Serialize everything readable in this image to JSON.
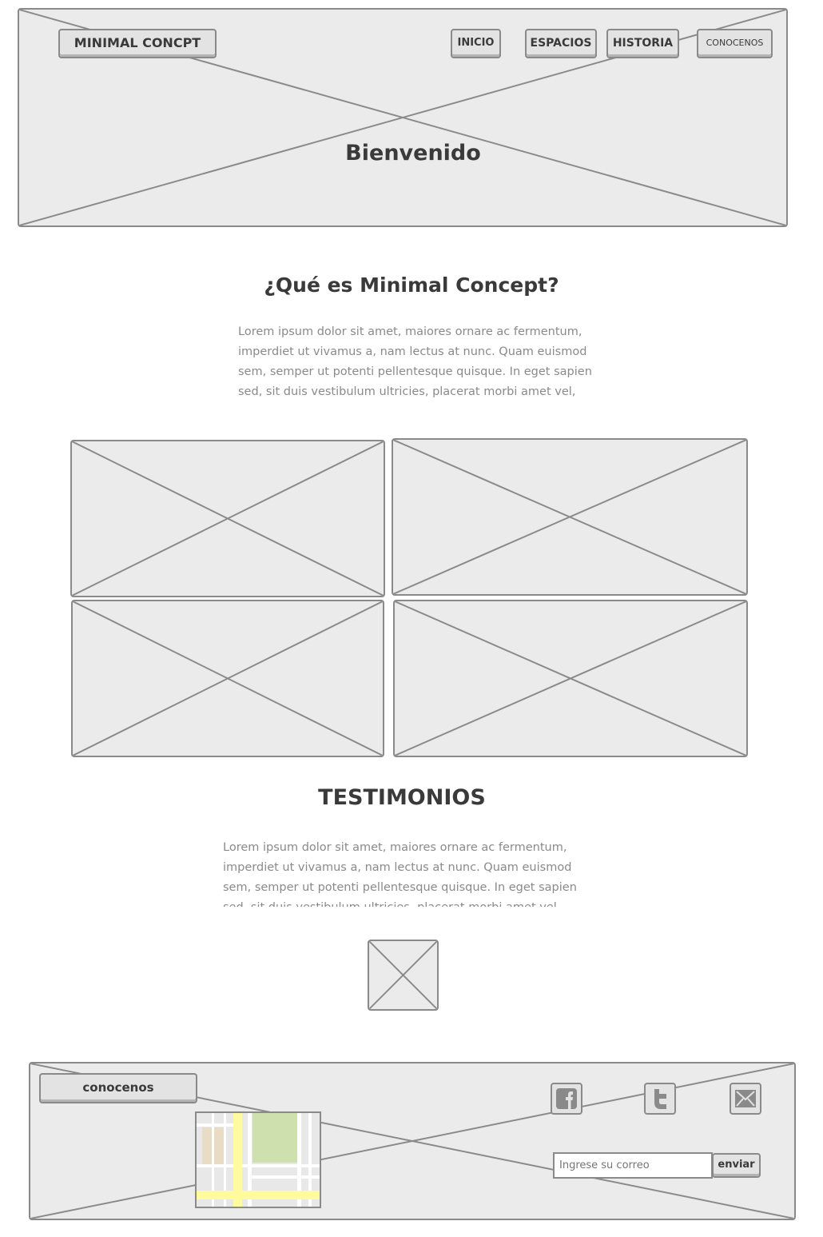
{
  "header": {
    "logo_label": "MINIMAL CONCPT",
    "nav": [
      {
        "label": "INICIO"
      },
      {
        "label": "ESPACIOS"
      },
      {
        "label": "HISTORIA"
      },
      {
        "label": "CONOCENOS"
      }
    ],
    "hero_title": "Bienvenido"
  },
  "about": {
    "title": "¿Qué es Minimal Concept?",
    "text": "Lorem ipsum dolor sit amet, maiores ornare ac fermentum, imperdiet ut vivamus a, nam lectus at nunc. Quam euismod sem, semper ut potenti pellentesque quisque. In eget sapien sed, sit duis vestibulum ultricies, placerat morbi amet vel,"
  },
  "testimonials": {
    "title": "TESTIMONIOS",
    "text": "Lorem ipsum dolor sit amet, maiores ornare ac fermentum, imperdiet ut vivamus a, nam lectus at nunc. Quam euismod sem, semper ut potenti pellentesque quisque. In eget sapien sed, sit duis vestibulum ultricies, placerat morbi amet vel,"
  },
  "footer": {
    "contact_label": "conocenos",
    "email_placeholder": "Ingrese su correo",
    "send_label": "enviar",
    "social_icons": [
      "facebook-icon",
      "twitter-icon",
      "mail-icon"
    ]
  },
  "colors": {
    "placeholder_bg": "#ebebeb",
    "stroke": "#8a8a8a",
    "text_dark": "#3a3a3a",
    "text_muted": "#8a8a8a",
    "map_road_yellow": "#fffb9e",
    "map_park_green": "#cde0ad"
  }
}
